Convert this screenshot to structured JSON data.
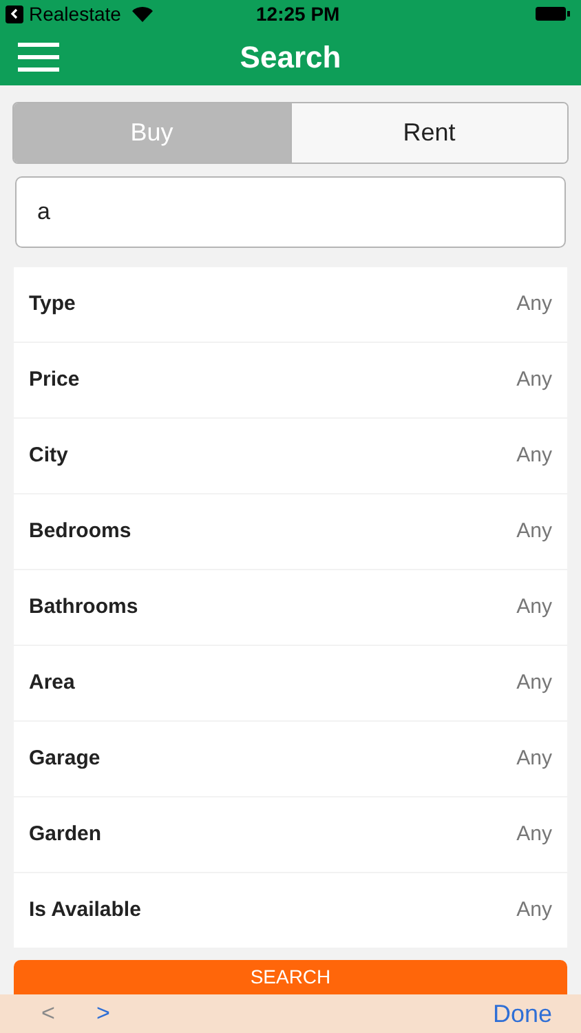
{
  "status_bar": {
    "back_app": "Realestate",
    "time": "12:25 PM"
  },
  "header": {
    "title": "Search"
  },
  "tabs": [
    {
      "label": "Buy",
      "selected": true
    },
    {
      "label": "Rent",
      "selected": false
    }
  ],
  "search": {
    "value": "a"
  },
  "filters": [
    {
      "label": "Type",
      "value": "Any"
    },
    {
      "label": "Price",
      "value": "Any"
    },
    {
      "label": "City",
      "value": "Any"
    },
    {
      "label": "Bedrooms",
      "value": "Any"
    },
    {
      "label": "Bathrooms",
      "value": "Any"
    },
    {
      "label": "Area",
      "value": "Any"
    },
    {
      "label": "Garage",
      "value": "Any"
    },
    {
      "label": "Garden",
      "value": "Any"
    },
    {
      "label": "Is Available",
      "value": "Any"
    }
  ],
  "search_button": "SEARCH",
  "keyboard_toolbar": {
    "previous": {
      "label": "<",
      "disabled": true
    },
    "next": {
      "label": ">",
      "disabled": false
    },
    "done": "Done"
  }
}
